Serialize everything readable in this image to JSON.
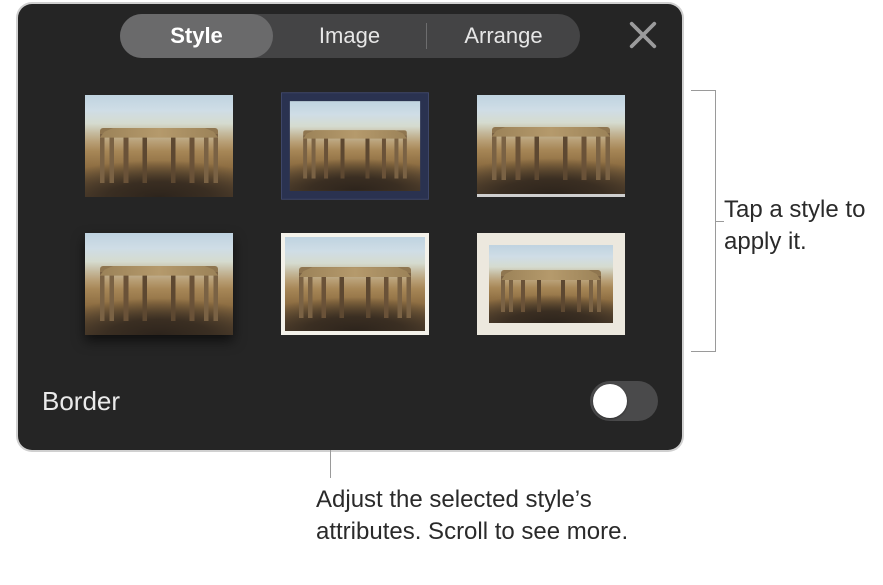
{
  "tabs": {
    "style": "Style",
    "image": "Image",
    "arrange": "Arrange",
    "selected_index": 0
  },
  "close_icon": "close",
  "styles": [
    {
      "variant": "plain",
      "selected": false,
      "icon": "image-style-plain"
    },
    {
      "variant": "darkframe",
      "selected": true,
      "icon": "image-style-dark-frame"
    },
    {
      "variant": "underline",
      "selected": false,
      "icon": "image-style-underline"
    },
    {
      "variant": "shadow",
      "selected": false,
      "icon": "image-style-shadow"
    },
    {
      "variant": "whiteedge",
      "selected": false,
      "icon": "image-style-white-edge"
    },
    {
      "variant": "matte",
      "selected": false,
      "icon": "image-style-matte"
    }
  ],
  "border": {
    "label": "Border",
    "value": false
  },
  "callouts": {
    "right": "Tap a style to apply it.",
    "bottom": "Adjust the selected style’s attributes. Scroll to see more."
  },
  "colors": {
    "panel_bg": "#252525",
    "tab_bg": "#444445",
    "tab_selected_bg": "#6a6a6b",
    "toggle_bg": "#4a4a4b"
  }
}
